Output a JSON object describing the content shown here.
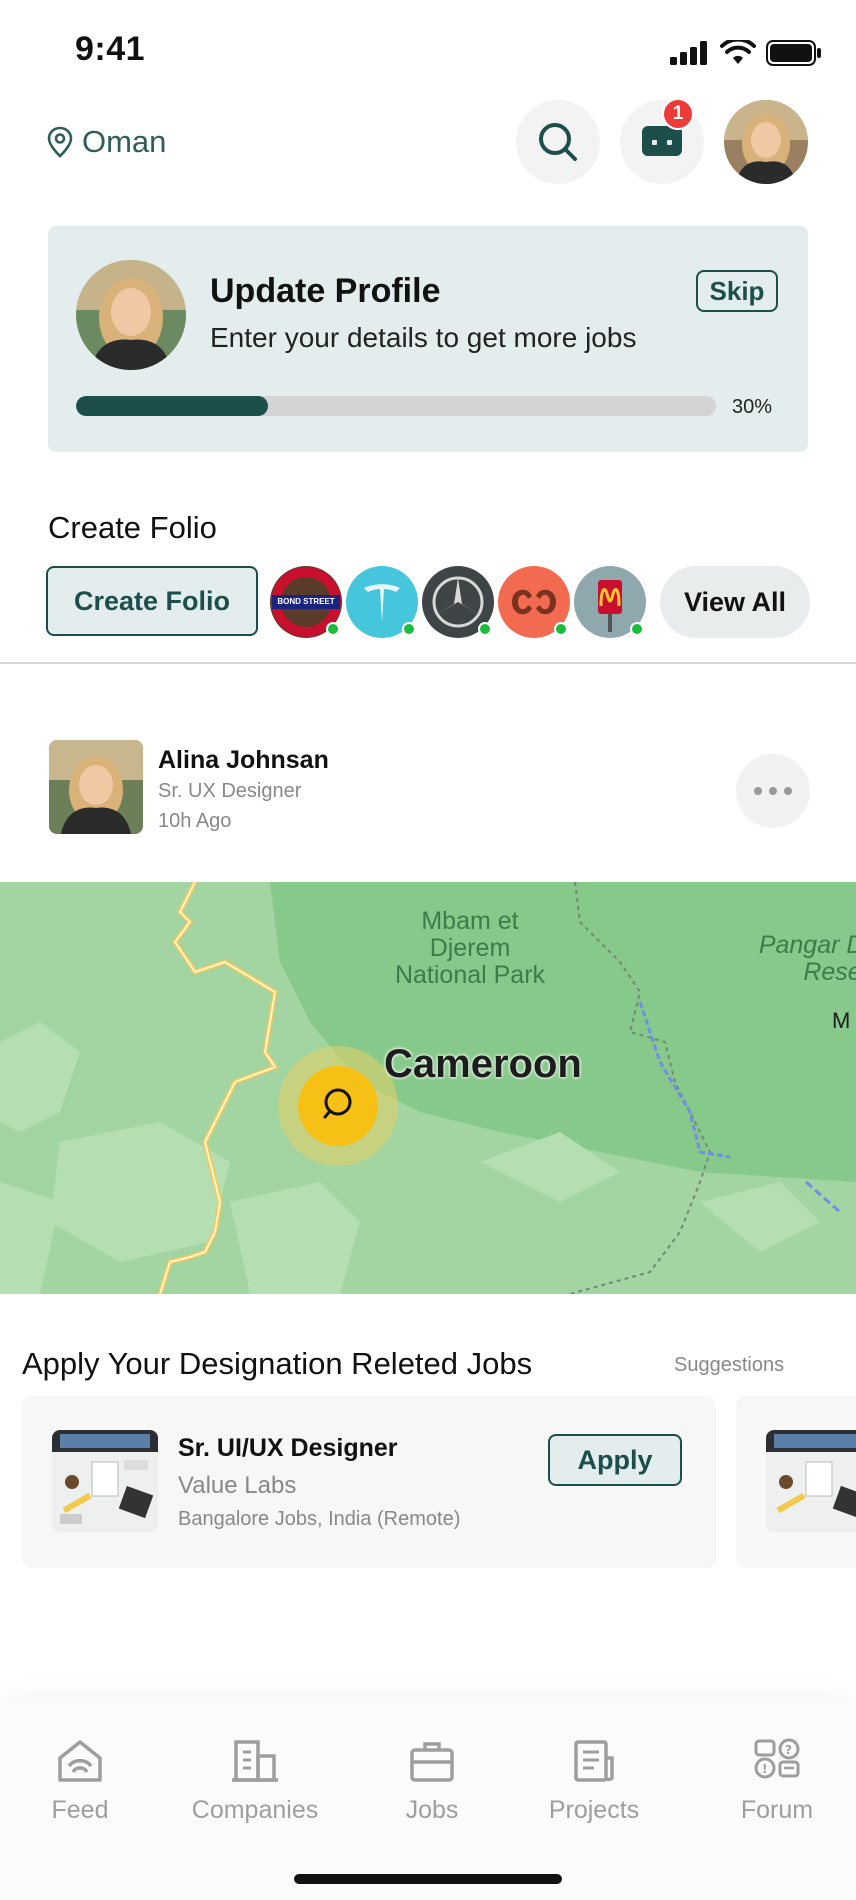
{
  "status_bar": {
    "time": "9:41"
  },
  "header": {
    "location": "Oman",
    "notification_count": "1"
  },
  "profile_card": {
    "title": "Update Profile",
    "subtitle": "Enter your details to get more jobs",
    "skip_label": "Skip",
    "progress": 0.3,
    "progress_label": "30%"
  },
  "folio": {
    "heading": "Create Folio",
    "create_label": "Create Folio",
    "view_all_label": "View All",
    "logos": [
      {
        "name": "bond-street-logo",
        "text": "BOND STREET"
      },
      {
        "name": "tesla-logo",
        "text": ""
      },
      {
        "name": "mercedes-logo",
        "text": ""
      },
      {
        "name": "brand-logo",
        "text": ""
      },
      {
        "name": "mcdonalds-logo",
        "text": ""
      }
    ]
  },
  "post": {
    "author": "Alina Johnsan",
    "role": "Sr. UX Designer",
    "time": "10h Ago"
  },
  "map": {
    "park_label_1": "Mbam et",
    "park_label_2": "Djerem",
    "park_label_3": "National Park",
    "country_label": "Cameroon",
    "right_label_1": "Pangar Dj",
    "right_label_2": "Reser",
    "right_label_3": "M"
  },
  "jobs": {
    "heading": "Apply Your Designation Releted Jobs",
    "suggestions_label": "Suggestions",
    "items": [
      {
        "title": "Sr. UI/UX Designer",
        "company": "Value Labs",
        "location": "Bangalore Jobs, India (Remote)",
        "apply_label": "Apply"
      }
    ]
  },
  "nav": {
    "items": [
      {
        "label": "Feed"
      },
      {
        "label": "Companies"
      },
      {
        "label": "Jobs"
      },
      {
        "label": "Projects"
      },
      {
        "label": "Forum"
      }
    ]
  },
  "colors": {
    "brand": "#1c4f4b",
    "card_bg": "#e3eded",
    "badge": "#ef3a3a",
    "online": "#1cbc3c",
    "map_pin": "#f6c114"
  }
}
